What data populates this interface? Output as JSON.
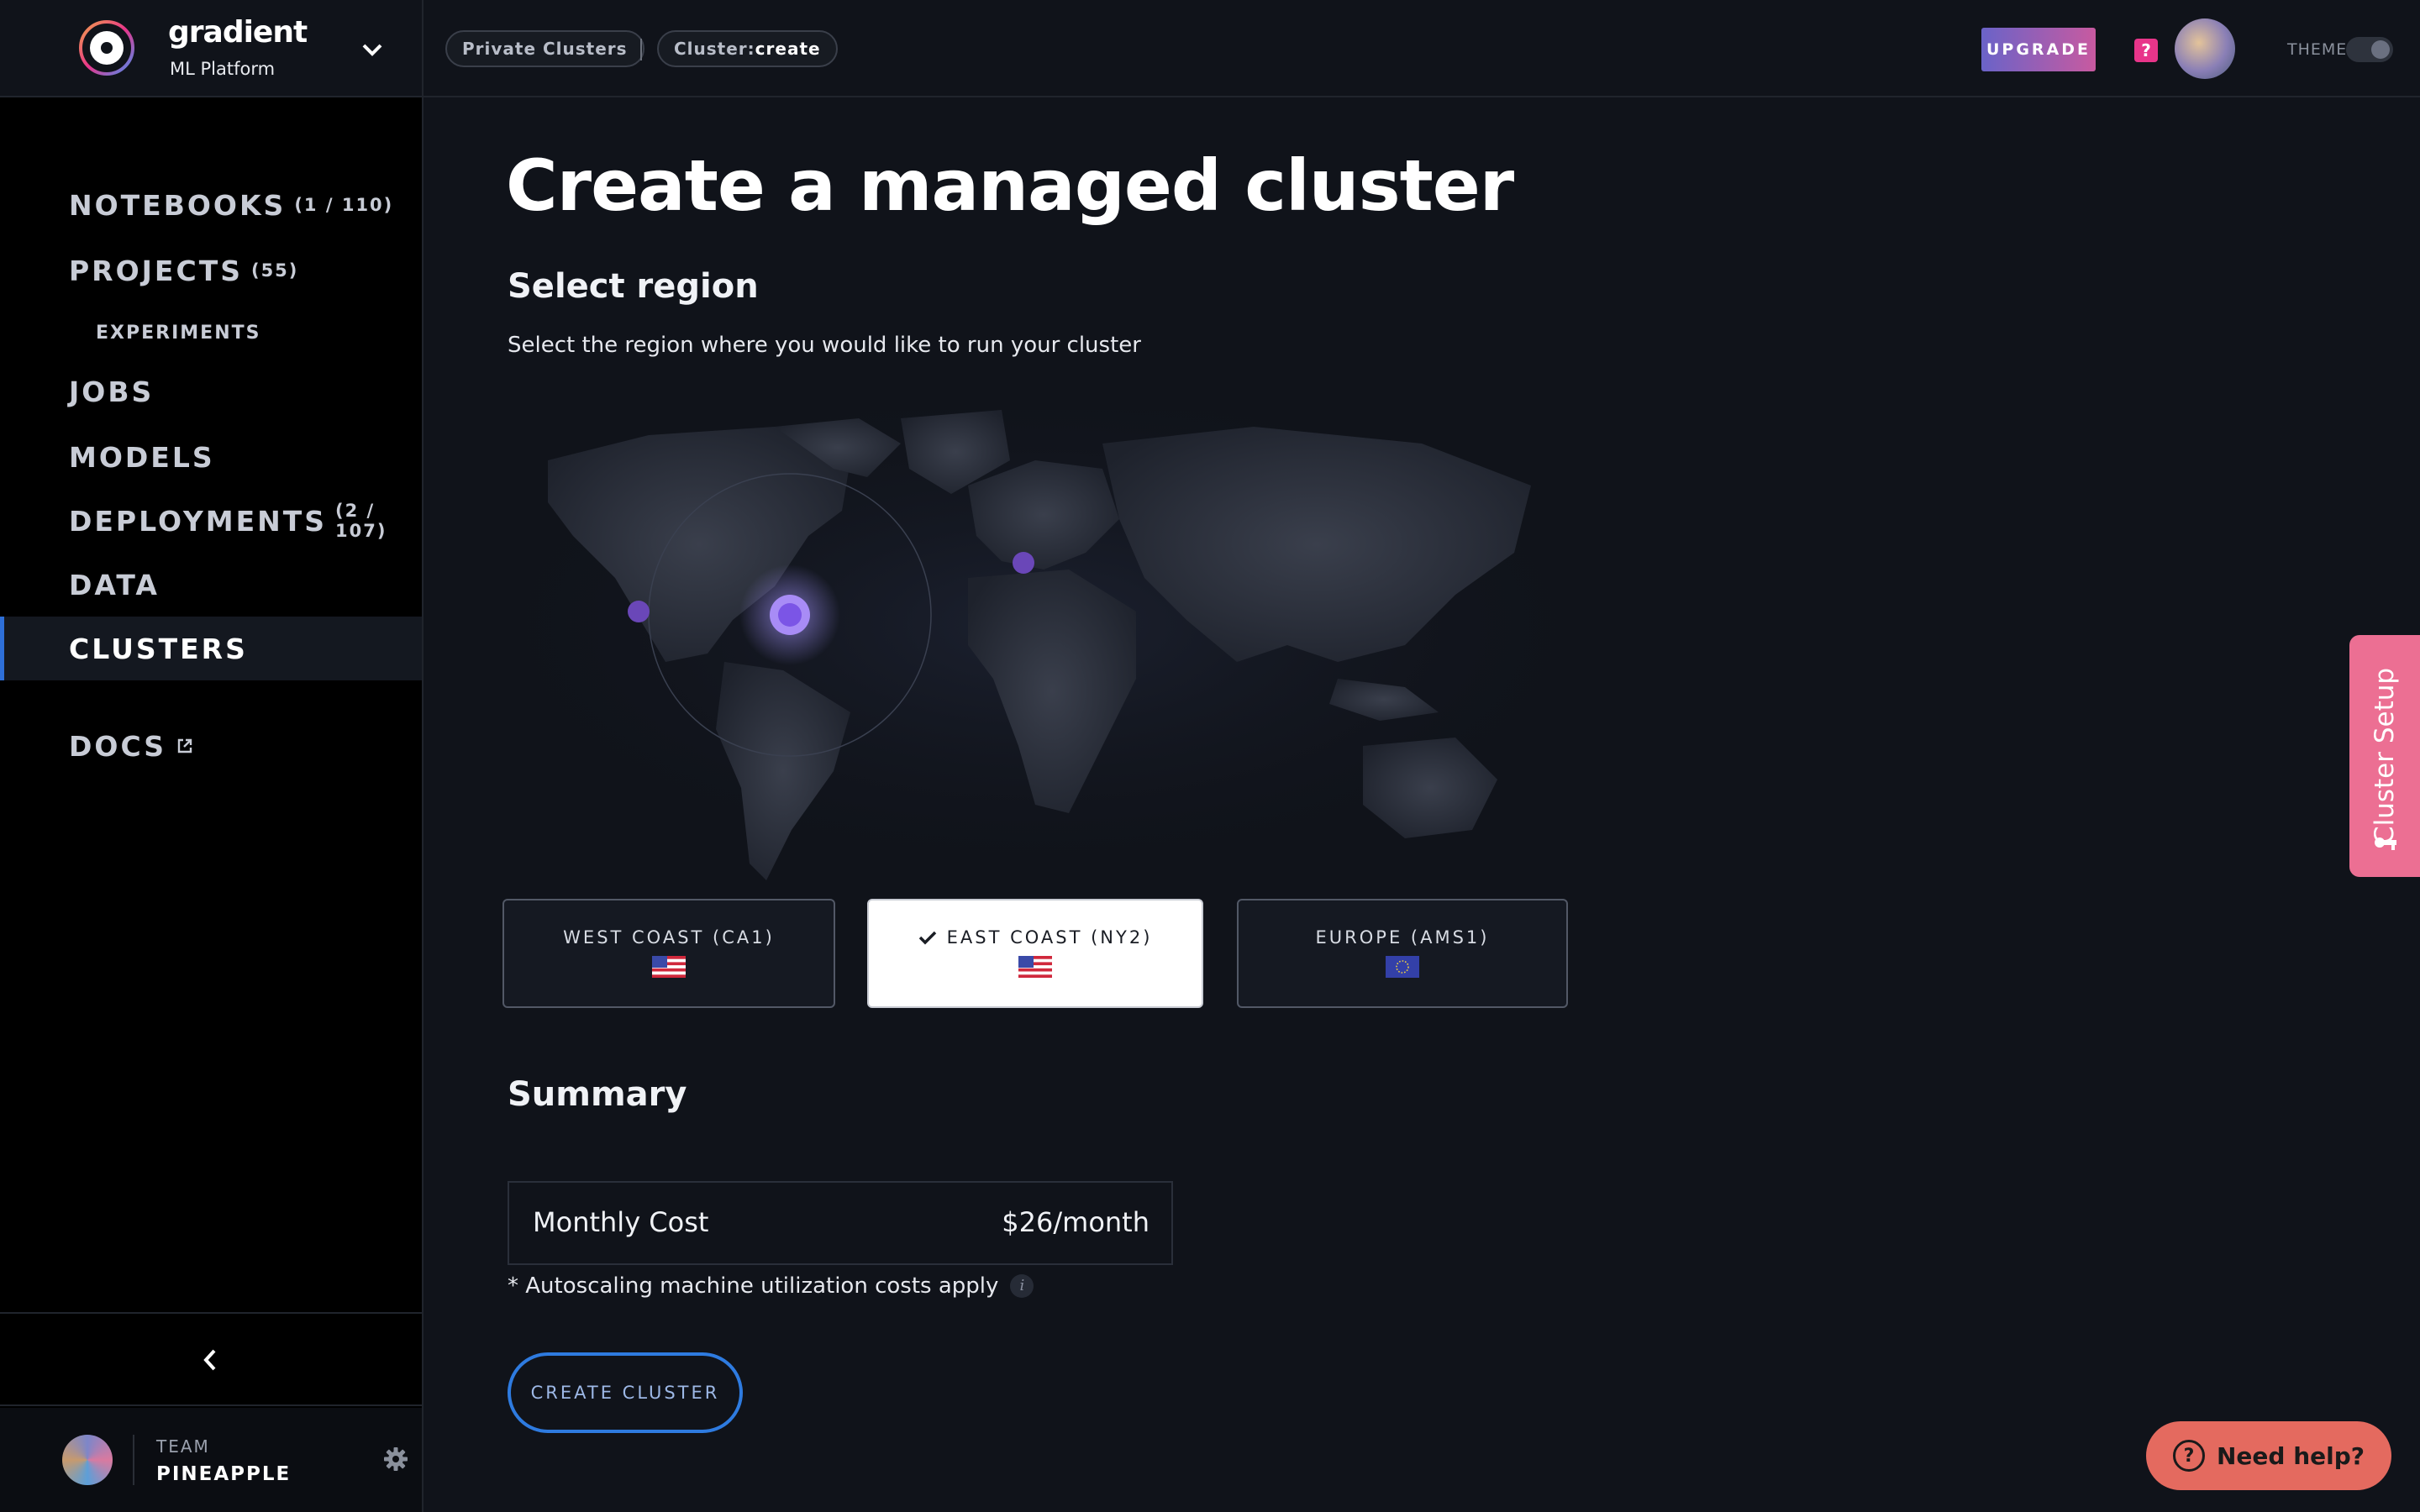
{
  "brand": {
    "name": "gradient",
    "subtitle": "ML Platform"
  },
  "sidebar": {
    "items": [
      {
        "label": "NOTEBOOKS",
        "count": "(1 / 110)"
      },
      {
        "label": "PROJECTS",
        "count": "(55)"
      },
      {
        "label": "EXPERIMENTS",
        "count": ""
      },
      {
        "label": "JOBS",
        "count": ""
      },
      {
        "label": "MODELS",
        "count": ""
      },
      {
        "label": "DEPLOYMENTS",
        "count": "(2 / 107)"
      },
      {
        "label": "DATA",
        "count": ""
      },
      {
        "label": "CLUSTERS",
        "count": ""
      },
      {
        "label": "DOCS",
        "count": ""
      }
    ],
    "active": "CLUSTERS"
  },
  "team": {
    "label": "TEAM",
    "name": "PINEAPPLE"
  },
  "topbar": {
    "crumbs": [
      "Private Clusters",
      "Cluster:",
      "create"
    ],
    "upgrade_label": "UPGRADE",
    "help_label": "?",
    "theme_label": "THEME"
  },
  "main": {
    "title": "Create a managed cluster",
    "region_heading": "Select region",
    "region_desc": "Select the region where you would like to run your cluster",
    "regions": [
      {
        "label": "WEST COAST (CA1)",
        "flag": "us-flag",
        "selected": false
      },
      {
        "label": "EAST COAST (NY2)",
        "flag": "us-flag",
        "selected": true
      },
      {
        "label": "EUROPE (AMS1)",
        "flag": "eu-flag",
        "selected": false
      }
    ],
    "summary_heading": "Summary",
    "cost_label": "Monthly Cost",
    "cost_value": "$26/month",
    "note": "* Autoscaling machine utilization costs apply",
    "info_icon": "i",
    "create_label": "CREATE CLUSTER"
  },
  "setup_tab": {
    "label": "Cluster Setup"
  },
  "help_button": {
    "label": "Need help?"
  },
  "colors": {
    "background": "#10131a",
    "accent_blue": "#2e7be0",
    "pink": "#ec6f93",
    "help_coral": "#e46a5f",
    "map_dot": "#8f5ce6"
  }
}
